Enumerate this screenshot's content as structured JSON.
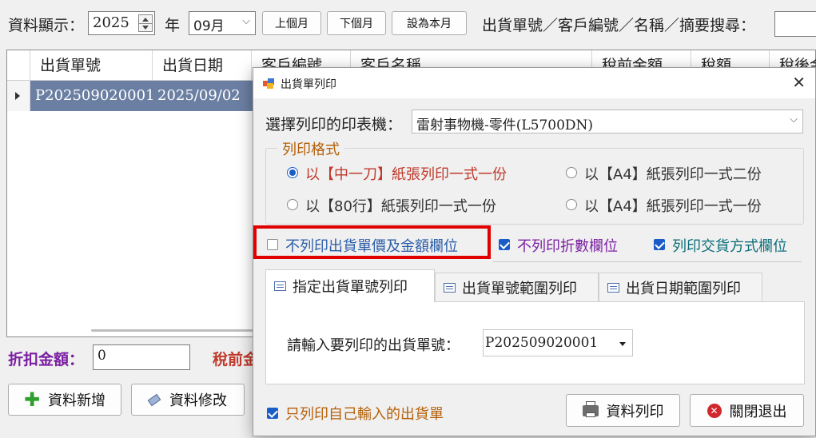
{
  "toolbar": {
    "label_display": "資料顯示：",
    "year_value": "2025",
    "year_label": "年",
    "month_value": "09月",
    "prev_month": "上個月",
    "next_month": "下個月",
    "this_month": "設為本月",
    "search_label": "出貨單號／客戶編號／名稱／摘要搜尋："
  },
  "grid": {
    "columns": [
      "出貨單號",
      "出貨日期",
      "客戶編號",
      "客戶名稱",
      "稅前金額",
      "稅額",
      "稅後金"
    ],
    "rows": [
      {
        "no": "P202509020001",
        "date": "2025/09/02"
      }
    ]
  },
  "bottom": {
    "discount_label": "折扣金額：",
    "discount_value": "0",
    "pretax_label": "稅前金",
    "add_button": "資料新增",
    "edit_button": "資料修改"
  },
  "dialog": {
    "title": "出貨單列印",
    "printer_label": "選擇列印的印表機：",
    "printer_value": "雷射事物機-零件(L5700DN)",
    "format_group": "列印格式",
    "formats": [
      "以【中一刀】紙張列印一式一份",
      "以【A4】紙張列印一式二份",
      "以【80行】紙張列印一式一份",
      "以【A4】紙張列印一式一份"
    ],
    "opt_no_price": "不列印出貨單價及金額欄位",
    "opt_no_discount": "不列印折數欄位",
    "opt_delivery": "列印交貨方式欄位",
    "tabs": [
      "指定出貨單號列印",
      "出貨單號範圍列印",
      "出貨日期範圍列印"
    ],
    "input_label": "請輸入要列印的出貨單號：",
    "input_value": "P202509020001",
    "opt_own_only": "只列印自己輸入的出貨單",
    "print_button": "資料列印",
    "close_button": "關閉退出"
  },
  "colors": {
    "selected_row": "#6b7fa3",
    "red_text": "#c0392b",
    "purple_text": "#7b1fa2",
    "blue_text": "#2a5da8",
    "teal_text": "#0b6e7a",
    "orange_text": "#b45f06",
    "highlight_box": "#e00000"
  }
}
